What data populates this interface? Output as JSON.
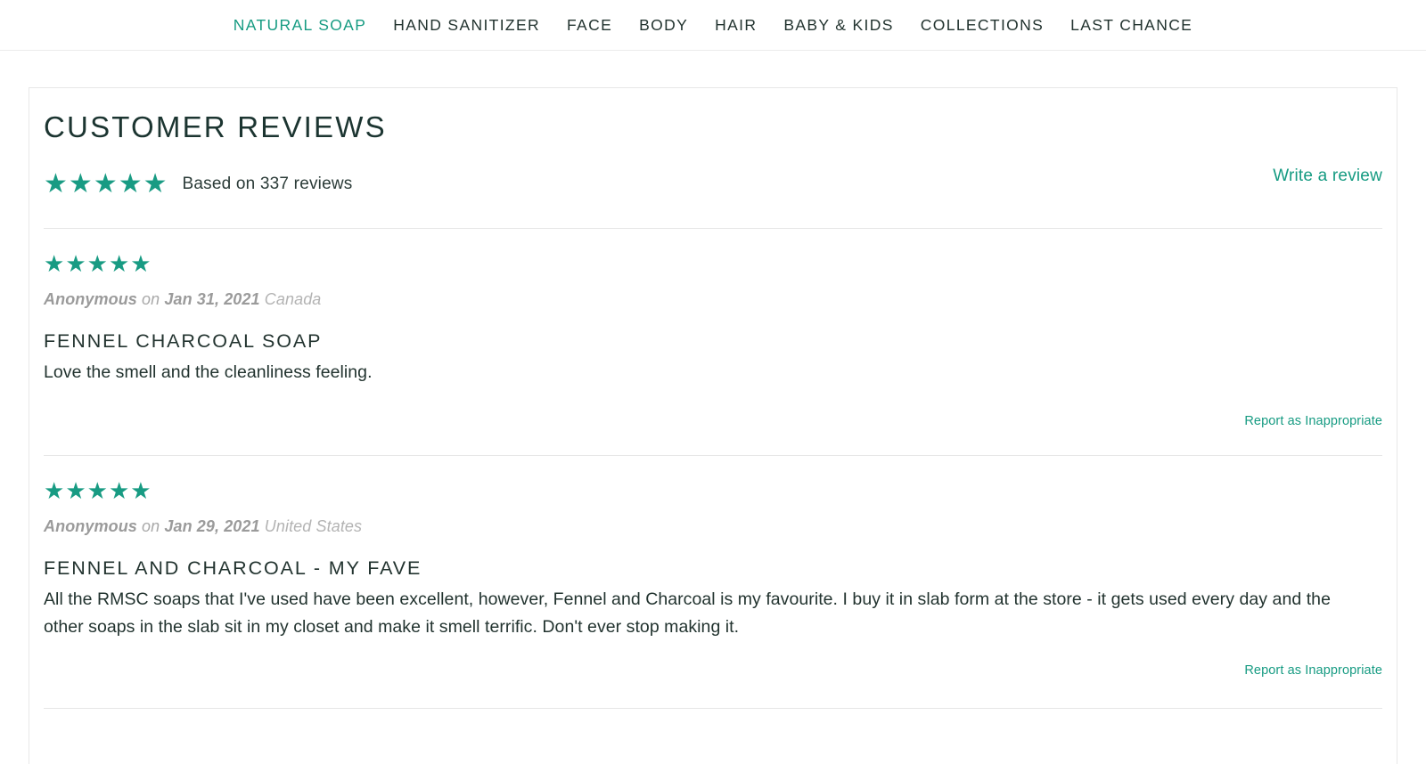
{
  "nav": {
    "items": [
      {
        "label": "NATURAL SOAP",
        "active": true
      },
      {
        "label": "HAND SANITIZER",
        "active": false
      },
      {
        "label": "FACE",
        "active": false
      },
      {
        "label": "BODY",
        "active": false
      },
      {
        "label": "HAIR",
        "active": false
      },
      {
        "label": "BABY & KIDS",
        "active": false
      },
      {
        "label": "COLLECTIONS",
        "active": false
      },
      {
        "label": "LAST CHANCE",
        "active": false
      }
    ]
  },
  "reviews_section": {
    "title": "CUSTOMER REVIEWS",
    "summary": {
      "rating": 5,
      "stars": "★★★★★",
      "text": "Based on 337 reviews",
      "review_count": 337
    },
    "write_review_label": "Write a review",
    "report_label": "Report as Inappropriate",
    "reviews": [
      {
        "rating": 5,
        "stars": "★★★★★",
        "author": "Anonymous",
        "on": "on",
        "date": "Jan 31, 2021",
        "location": "Canada",
        "title": "FENNEL CHARCOAL SOAP",
        "body": "Love the smell and the cleanliness feeling.",
        "report_label": "Report as Inappropriate"
      },
      {
        "rating": 5,
        "stars": "★★★★★",
        "author": "Anonymous",
        "on": "on",
        "date": "Jan 29, 2021",
        "location": "United States",
        "title": "FENNEL AND CHARCOAL - MY FAVE",
        "body": "All the RMSC soaps that I've used have been excellent, however, Fennel and Charcoal is my favourite. I buy it in slab form at the store - it gets used every day and the other soaps in the slab sit in my closet and make it smell terrific. Don't ever stop making it.",
        "report_label": "Report as Inappropriate"
      }
    ]
  },
  "colors": {
    "accent_teal": "#169b82",
    "star_teal": "#189b83",
    "heading_dark": "#1c3531",
    "meta_gray": "#a9a9a9",
    "divider": "#e6e6e6"
  }
}
